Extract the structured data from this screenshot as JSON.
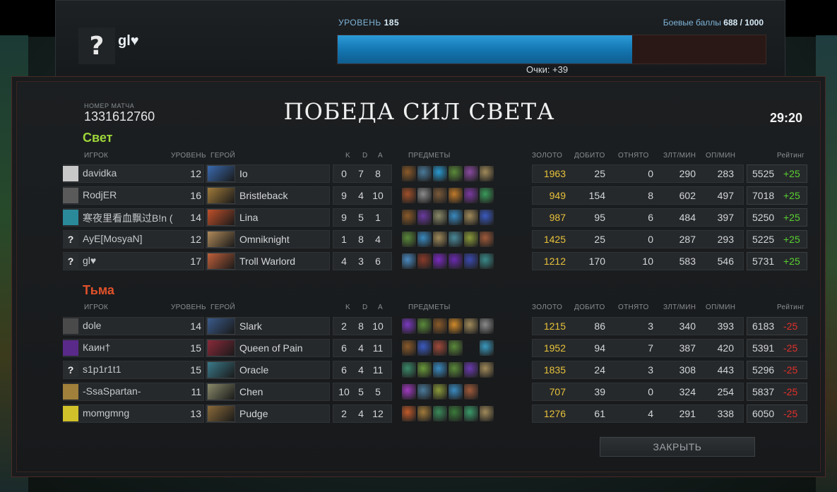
{
  "header": {
    "player_name": "gl♥",
    "avatar_glyph": "?",
    "level_label": "УРОВЕНЬ",
    "level_value": "185",
    "battle_points_label": "Боевые баллы",
    "battle_points_value": "688 / 1000",
    "battle_points_fraction": 0.688,
    "points_text": "Очки: +39"
  },
  "match": {
    "id_label": "НОМЕР МАТЧА",
    "id": "1331612760",
    "title": "ПОБЕДА СИЛ СВЕТА",
    "duration": "29:20"
  },
  "columns": {
    "player": "ИГРОК",
    "level": "УРОВЕНЬ",
    "hero": "ГЕРОЙ",
    "k": "K",
    "d": "D",
    "a": "A",
    "items": "ПРЕДМЕТЫ",
    "gold": "ЗОЛОТО",
    "last_hits": "ДОБИТО",
    "denies": "ОТНЯТО",
    "gpm": "ЗЛТ/МИН",
    "xpm": "ОП/МИН",
    "rating": "Рейтинг"
  },
  "teams": {
    "radiant": {
      "name": "Свет",
      "color": "#9ed63a",
      "players": [
        {
          "avatar": "",
          "avatar_color": "#c8c8c8",
          "name": "davidka",
          "level": "12",
          "hero": "Io",
          "hero_color": "#3a6ab0",
          "k": "0",
          "d": "7",
          "a": "8",
          "items": [
            "#8a5a2a",
            "#4a7a9a",
            "#2a9ad0",
            "#5a8a3a",
            "#8a4aa0",
            "#a08a5a"
          ],
          "gold": "1963",
          "last_hits": "25",
          "denies": "0",
          "gpm": "290",
          "xpm": "283",
          "rating": "5525",
          "delta": "+25"
        },
        {
          "avatar": "",
          "avatar_color": "#5a5a5a",
          "name": "RodjER",
          "level": "16",
          "hero": "Bristleback",
          "hero_color": "#a07a3a",
          "k": "9",
          "d": "4",
          "a": "10",
          "items": [
            "#a0502a",
            "#8a8a8a",
            "#7a5a3a",
            "#c07a2a",
            "#7a3aa0",
            "#3a9a5a"
          ],
          "gold": "949",
          "last_hits": "154",
          "denies": "8",
          "gpm": "602",
          "xpm": "497",
          "rating": "7018",
          "delta": "+25"
        },
        {
          "avatar": "",
          "avatar_color": "#2a8a9a",
          "name": "寒夜里看血飘过B!n (",
          "level": "14",
          "hero": "Lina",
          "hero_color": "#c0502a",
          "k": "9",
          "d": "5",
          "a": "1",
          "items": [
            "#8a5a2a",
            "#6a3aa0",
            "#8a8a6a",
            "#3a8ac0",
            "#a08a5a",
            "#3a5ac0"
          ],
          "gold": "987",
          "last_hits": "95",
          "denies": "6",
          "gpm": "484",
          "xpm": "397",
          "rating": "5250",
          "delta": "+25"
        },
        {
          "avatar": "?",
          "avatar_color": "#2a2d30",
          "name": "AyE[MosyaN]",
          "level": "12",
          "hero": "Omniknight",
          "hero_color": "#b08a5a",
          "k": "1",
          "d": "8",
          "a": "4",
          "items": [
            "#5a8a3a",
            "#3a8ac0",
            "#a08a5a",
            "#4a8a9a",
            "#8a9a3a",
            "#a05a3a"
          ],
          "gold": "1425",
          "last_hits": "25",
          "denies": "0",
          "gpm": "287",
          "xpm": "293",
          "rating": "5225",
          "delta": "+25"
        },
        {
          "avatar": "?",
          "avatar_color": "#2a2d30",
          "name": "gl♥",
          "level": "17",
          "hero": "Troll Warlord",
          "hero_color": "#c0603a",
          "k": "4",
          "d": "3",
          "a": "6",
          "items": [
            "#4a8ac0",
            "#8a3a2a",
            "#7a2ac0",
            "#6a2ab0",
            "#3a4ab0",
            "#3a8a8a"
          ],
          "gold": "1212",
          "last_hits": "170",
          "denies": "10",
          "gpm": "583",
          "xpm": "546",
          "rating": "5731",
          "delta": "+25"
        }
      ]
    },
    "dire": {
      "name": "Тьма",
      "color": "#e0522a",
      "players": [
        {
          "avatar": "",
          "avatar_color": "#4a4a4a",
          "name": "dole",
          "level": "14",
          "hero": "Slark",
          "hero_color": "#3a5a8a",
          "k": "2",
          "d": "8",
          "a": "10",
          "items": [
            "#7a3ac0",
            "#5a8a3a",
            "#8a5a2a",
            "#d08a2a",
            "#a08a5a",
            "#8a8a8a"
          ],
          "gold": "1215",
          "last_hits": "86",
          "denies": "3",
          "gpm": "340",
          "xpm": "393",
          "rating": "6183",
          "delta": "-25"
        },
        {
          "avatar": "",
          "avatar_color": "#5a2a8a",
          "name": "Каин†",
          "level": "15",
          "hero": "Queen of Pain",
          "hero_color": "#8a2a3a",
          "k": "6",
          "d": "4",
          "a": "11",
          "items": [
            "#8a5a2a",
            "#3a5ac0",
            "#a04a3a",
            "#5a8a3a",
            "transparent",
            "#3a9ac0"
          ],
          "gold": "1952",
          "last_hits": "94",
          "denies": "7",
          "gpm": "387",
          "xpm": "420",
          "rating": "5391",
          "delta": "-25"
        },
        {
          "avatar": "?",
          "avatar_color": "#2a2d30",
          "name": "s1p1r1t1",
          "level": "15",
          "hero": "Oracle",
          "hero_color": "#3a7a8a",
          "k": "6",
          "d": "4",
          "a": "11",
          "items": [
            "#3a8a6a",
            "#6a9a3a",
            "#3a8ac0",
            "#5a8a3a",
            "#6a3ab0",
            "#a08a5a"
          ],
          "gold": "1835",
          "last_hits": "24",
          "denies": "3",
          "gpm": "308",
          "xpm": "443",
          "rating": "5296",
          "delta": "-25"
        },
        {
          "avatar": "",
          "avatar_color": "#a0803a",
          "name": "-SsaSpartan-",
          "level": "11",
          "hero": "Chen",
          "hero_color": "#8a8a6a",
          "k": "10",
          "d": "5",
          "a": "5",
          "items": [
            "#a03ac0",
            "#4a7a9a",
            "#8a9a3a",
            "#3a8ac0",
            "#a05a3a"
          ],
          "gold": "707",
          "last_hits": "39",
          "denies": "0",
          "gpm": "324",
          "xpm": "254",
          "rating": "5837",
          "delta": "-25"
        },
        {
          "avatar": "",
          "avatar_color": "#d0c02a",
          "name": "momgmng",
          "level": "13",
          "hero": "Pudge",
          "hero_color": "#8a6a3a",
          "k": "2",
          "d": "4",
          "a": "12",
          "items": [
            "#c05a2a",
            "#a07a3a",
            "#3a8a5a",
            "#3a7a3a",
            "#3a9a6a",
            "#a08a5a"
          ],
          "gold": "1276",
          "last_hits": "61",
          "denies": "4",
          "gpm": "291",
          "xpm": "338",
          "rating": "6050",
          "delta": "-25"
        }
      ]
    }
  },
  "buttons": {
    "close": "ЗАКРЫТЬ"
  }
}
